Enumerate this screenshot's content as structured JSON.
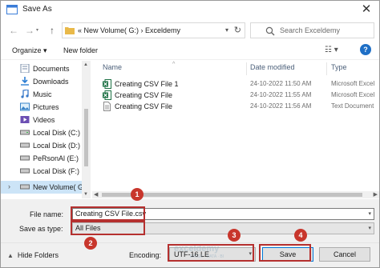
{
  "window": {
    "title": "Save As",
    "close_glyph": "✕"
  },
  "nav": {
    "back_glyph": "←",
    "forward_glyph": "→",
    "up_glyph": "↑",
    "address": "« New Volume( G:) › Exceldemy",
    "search_placeholder": "Search Exceldemy"
  },
  "toolbar": {
    "organize": "Organize ▾",
    "new_folder": "New folder",
    "view_glyph": "☷ ▾",
    "help_glyph": "?"
  },
  "sidebar": {
    "items": [
      {
        "label": "Documents",
        "icon": "documents-icon"
      },
      {
        "label": "Downloads",
        "icon": "downloads-icon"
      },
      {
        "label": "Music",
        "icon": "music-icon"
      },
      {
        "label": "Pictures",
        "icon": "pictures-icon"
      },
      {
        "label": "Videos",
        "icon": "videos-icon"
      },
      {
        "label": "Local Disk (C:)",
        "icon": "drive-icon"
      },
      {
        "label": "Local Disk (D:)",
        "icon": "drive-icon"
      },
      {
        "label": "PeRsonAl (E:)",
        "icon": "drive-icon"
      },
      {
        "label": "Local Disk (F:)",
        "icon": "drive-icon"
      },
      {
        "label": "New Volume( G:)",
        "icon": "drive-icon",
        "selected": true
      }
    ]
  },
  "columns": {
    "name": "Name",
    "date": "Date modified",
    "type": "Type"
  },
  "files": [
    {
      "name": "Creating CSV File 1",
      "date": "24-10-2022 11:50 AM",
      "type": "Microsoft Excel",
      "icon": "excel-file-icon"
    },
    {
      "name": "Creating CSV File",
      "date": "24-10-2022 11:55 AM",
      "type": "Microsoft Excel",
      "icon": "excel-file-icon"
    },
    {
      "name": "Creating CSV File",
      "date": "24-10-2022 11:56 AM",
      "type": "Text Document",
      "icon": "text-file-icon"
    }
  ],
  "form": {
    "file_name_label": "File name:",
    "file_name_value": "Creating CSV File.csv",
    "save_as_type_label": "Save as type:",
    "save_as_type_value": "All Files"
  },
  "footer": {
    "hide_folders": "Hide Folders",
    "encoding_label": "Encoding:",
    "encoding_value": "UTF-16 LE",
    "save": "Save",
    "cancel": "Cancel"
  },
  "watermark": {
    "text": "exceldemy",
    "sub": "EXCEL · DATA · BI"
  },
  "annotations": {
    "step1": "1",
    "step2": "2",
    "step3": "3",
    "step4": "4",
    "color": "#c8362c"
  }
}
